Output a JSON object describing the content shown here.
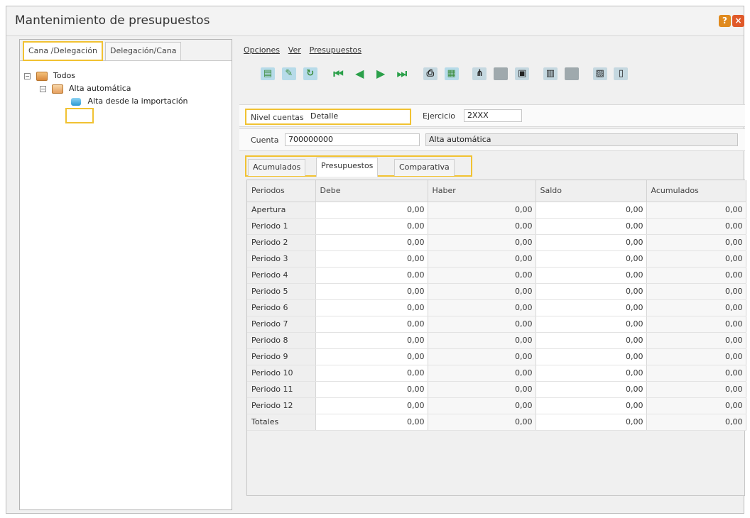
{
  "window": {
    "title": "Mantenimiento de presupuestos",
    "help_icon": "help-icon",
    "close_icon": "close-icon"
  },
  "left_panel": {
    "tabs": [
      {
        "label": "Cana /Delegación"
      },
      {
        "label": "Delegación/Cana"
      }
    ],
    "tree": {
      "root": "Todos",
      "child": "Alta automática",
      "leaf": "Alta desde la importación"
    }
  },
  "menu": [
    "Opciones",
    "Ver",
    "Presupuestos"
  ],
  "fields": {
    "nivel_label": "Nivel cuentas",
    "nivel_value": "Detalle",
    "ejercicio_label": "Ejercicio",
    "ejercicio_value": "2XXX",
    "cuenta_label": "Cuenta",
    "cuenta_value": "700000000",
    "cuenta_desc": "Alta automática"
  },
  "tabs": [
    {
      "label": "Acumulados"
    },
    {
      "label": "Presupuestos"
    },
    {
      "label": "Comparativa"
    }
  ],
  "grid": {
    "headers": [
      "Periodos",
      "Debe",
      "Haber",
      "Saldo",
      "Acumulados"
    ],
    "rows": [
      {
        "label": "Apertura",
        "values": [
          "0,00",
          "0,00",
          "0,00",
          "0,00"
        ]
      },
      {
        "label": "Periodo 1",
        "values": [
          "0,00",
          "0,00",
          "0,00",
          "0,00"
        ]
      },
      {
        "label": "Periodo 2",
        "values": [
          "0,00",
          "0,00",
          "0,00",
          "0,00"
        ]
      },
      {
        "label": "Periodo 3",
        "values": [
          "0,00",
          "0,00",
          "0,00",
          "0,00"
        ]
      },
      {
        "label": "Periodo 4",
        "values": [
          "0,00",
          "0,00",
          "0,00",
          "0,00"
        ]
      },
      {
        "label": "Periodo 5",
        "values": [
          "0,00",
          "0,00",
          "0,00",
          "0,00"
        ]
      },
      {
        "label": "Periodo 6",
        "values": [
          "0,00",
          "0,00",
          "0,00",
          "0,00"
        ]
      },
      {
        "label": "Periodo 7",
        "values": [
          "0,00",
          "0,00",
          "0,00",
          "0,00"
        ]
      },
      {
        "label": "Periodo 8",
        "values": [
          "0,00",
          "0,00",
          "0,00",
          "0,00"
        ]
      },
      {
        "label": "Periodo 9",
        "values": [
          "0,00",
          "0,00",
          "0,00",
          "0,00"
        ]
      },
      {
        "label": "Periodo 10",
        "values": [
          "0,00",
          "0,00",
          "0,00",
          "0,00"
        ]
      },
      {
        "label": "Periodo 11",
        "values": [
          "0,00",
          "0,00",
          "0,00",
          "0,00"
        ]
      },
      {
        "label": "Periodo 12",
        "values": [
          "0,00",
          "0,00",
          "0,00",
          "0,00"
        ]
      },
      {
        "label": "Totales",
        "values": [
          "0,00",
          "0,00",
          "0,00",
          "0,00"
        ]
      }
    ]
  },
  "colors": {
    "highlight": "#f1c232",
    "nav_green": "#2ba04a"
  }
}
